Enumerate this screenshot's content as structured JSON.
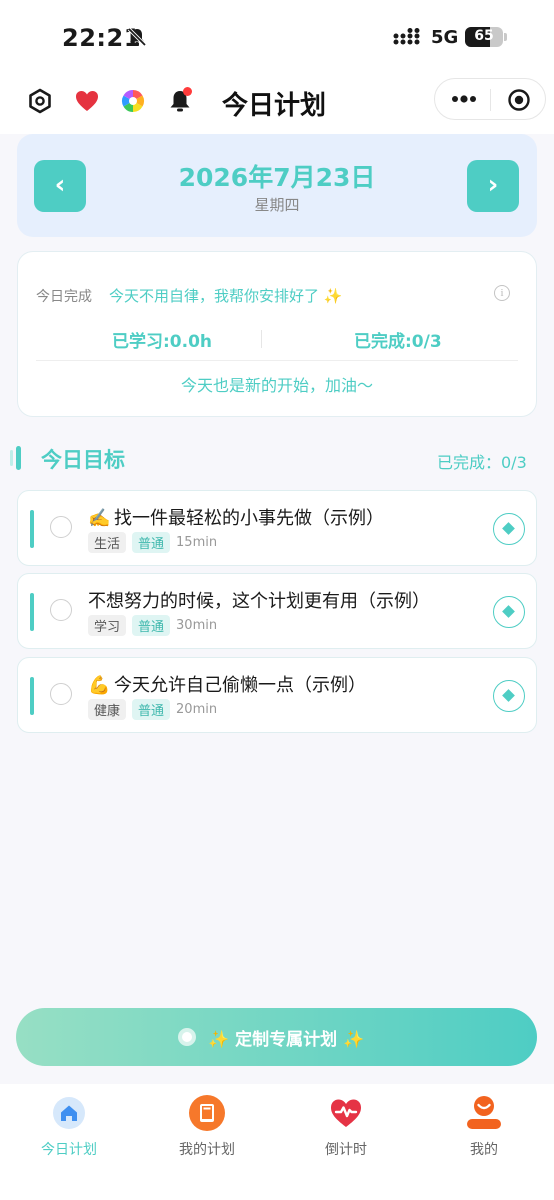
{
  "status_bar": {
    "time": "22:21",
    "network": "5G",
    "battery": "65",
    "battery_level": 0.65
  },
  "header": {
    "title": "今日计划"
  },
  "date_card": {
    "prev_label": "‹",
    "next_label": "›",
    "date": "2026年7月23日",
    "weekday": "星期四"
  },
  "summary": {
    "label": "今日完成",
    "slogan": "今天不用自律，我帮你安排好了 ✨",
    "info_icon": "i",
    "learned": "已学习:0.0h",
    "completed": "已完成:0/3",
    "cheer": "今天也是新的开始，加油～"
  },
  "goals": {
    "title": "今日目标",
    "count": "已完成：0/3",
    "items": [
      {
        "emoji": "✍️",
        "title": "找一件最轻松的小事先做（示例）",
        "category": "生活",
        "level": "普通",
        "duration": "15min"
      },
      {
        "emoji": "",
        "title": "不想努力的时候，这个计划更有用（示例）",
        "category": "学习",
        "level": "普通",
        "duration": "30min"
      },
      {
        "emoji": "💪",
        "title": "今天允许自己偷懒一点（示例）",
        "category": "健康",
        "level": "普通",
        "duration": "20min"
      }
    ]
  },
  "custom_button": {
    "spark_left": "✨",
    "label": "定制专属计划",
    "spark_right": "✨"
  },
  "tabbar": {
    "tabs": [
      {
        "label": "今日计划",
        "icon": "home-icon"
      },
      {
        "label": "我的计划",
        "icon": "book-icon"
      },
      {
        "label": "倒计时",
        "icon": "heart-pulse-icon"
      },
      {
        "label": "我的",
        "icon": "user-icon"
      }
    ]
  },
  "colors": {
    "accent": "#4ecdc4",
    "date_card_bg": "#e6effd",
    "page_bg": "#f7f7fb"
  }
}
